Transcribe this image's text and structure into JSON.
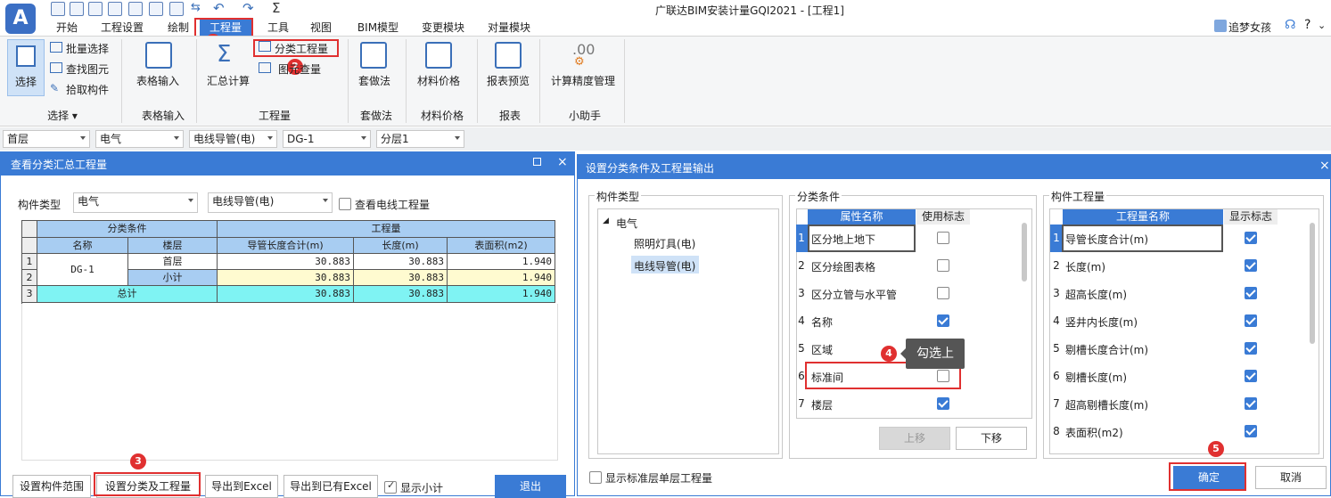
{
  "app": {
    "title": "广联达BIM安装计量GQI2021 - [工程1]",
    "user": "追梦女孩"
  },
  "menu": [
    "开始",
    "工程设置",
    "绘制",
    "工程量",
    "工具",
    "视图",
    "BIM模型",
    "变更模块",
    "对量模块"
  ],
  "ribbon": {
    "select": {
      "big": "选择",
      "items": [
        "批量选择",
        "查找图元",
        "拾取构件"
      ],
      "group": "选择"
    },
    "table_input": {
      "big": "表格输入",
      "group": "表格输入"
    },
    "quantity": {
      "sum": "汇总计算",
      "cat": "分类工程量",
      "graph": "图元查量",
      "group": "工程量"
    },
    "method": {
      "big": "套做法",
      "group": "套做法"
    },
    "material": {
      "big": "材料价格",
      "group": "材料价格"
    },
    "report": {
      "big": "报表预览",
      "group": "报表"
    },
    "helper": {
      "big": "计算精度管理",
      "group": "小助手",
      "icon_text": ".00"
    }
  },
  "toolbar": {
    "floor": "首层",
    "major": "电气",
    "type": "电线导管(电)",
    "name": "DG-1",
    "layer": "分层1"
  },
  "left_panel": {
    "title": "查看分类汇总工程量",
    "comp_type_label": "构件类型",
    "comp_major": "电气",
    "comp_type": "电线导管(电)",
    "view_wire_label": "查看电线工程量",
    "table": {
      "group_headers": [
        "分类条件",
        "工程量"
      ],
      "headers": [
        "名称",
        "楼层",
        "导管长度合计(m)",
        "长度(m)",
        "表面积(m2)"
      ],
      "rows": [
        {
          "num": "1",
          "name": "DG-1",
          "floor": "首层",
          "v1": "30.883",
          "v2": "30.883",
          "v3": "1.940"
        },
        {
          "num": "2",
          "name": "",
          "floor": "小计",
          "v1": "30.883",
          "v2": "30.883",
          "v3": "1.940"
        },
        {
          "num": "3",
          "name": "总计",
          "floor": "",
          "v1": "30.883",
          "v2": "30.883",
          "v3": "1.940"
        }
      ]
    },
    "buttons": {
      "scope": "设置构件范围",
      "setcat": "设置分类及工程量",
      "excel": "导出到Excel",
      "excel2": "导出到已有Excel",
      "subtotal": "显示小计",
      "exit": "退出"
    }
  },
  "dialog": {
    "title": "设置分类条件及工程量输出",
    "comp_group": "构件类型",
    "tree": {
      "root": "电气",
      "children": [
        "照明灯具(电)",
        "电线导管(电)"
      ]
    },
    "cond_group": "分类条件",
    "cond_headers": [
      "属性名称",
      "使用标志"
    ],
    "conds": [
      {
        "n": "1",
        "name": "区分地上地下",
        "on": false
      },
      {
        "n": "2",
        "name": "区分绘图表格",
        "on": false
      },
      {
        "n": "3",
        "name": "区分立管与水平管",
        "on": false
      },
      {
        "n": "4",
        "name": "名称",
        "on": true
      },
      {
        "n": "5",
        "name": "区域",
        "on": false
      },
      {
        "n": "6",
        "name": "标准间",
        "on": false
      },
      {
        "n": "7",
        "name": "楼层",
        "on": true
      }
    ],
    "tooltip": "勾选上",
    "up": "上移",
    "down": "下移",
    "qty_group": "构件工程量",
    "qty_headers": [
      "工程量名称",
      "显示标志"
    ],
    "qtys": [
      {
        "n": "1",
        "name": "导管长度合计(m)"
      },
      {
        "n": "2",
        "name": "长度(m)"
      },
      {
        "n": "3",
        "name": "超高长度(m)"
      },
      {
        "n": "4",
        "name": "竖井内长度(m)"
      },
      {
        "n": "5",
        "name": "剔槽长度合计(m)"
      },
      {
        "n": "6",
        "name": "剔槽长度(m)"
      },
      {
        "n": "7",
        "name": "超高剔槽长度(m)"
      },
      {
        "n": "8",
        "name": "表面积(m2)"
      }
    ],
    "std_floor": "显示标准层单层工程量",
    "ok": "确定",
    "cancel": "取消"
  },
  "badges": [
    "1",
    "2",
    "3",
    "4",
    "5"
  ],
  "colors": {
    "accent": "#3a7bd5",
    "highlight": "#e03030",
    "total_row": "#7ff3f3",
    "subtotal_row": "#fffbd0",
    "header_cell": "#a8cdf2"
  }
}
